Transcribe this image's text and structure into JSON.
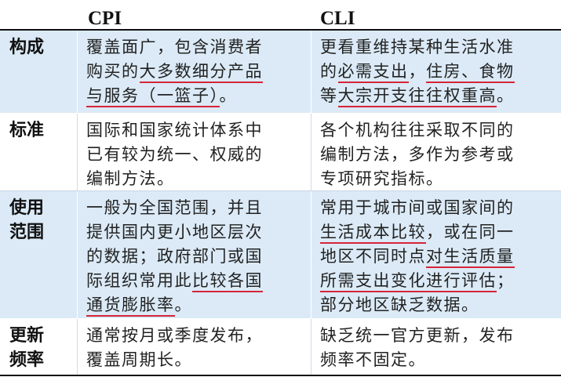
{
  "header": {
    "col1": "CPI",
    "col2": "CLI"
  },
  "rows": [
    {
      "label": [
        "构成"
      ],
      "cpi": [
        [
          {
            "t": "覆盖面广，包含消费者"
          }
        ],
        [
          {
            "t": "购买的"
          },
          {
            "t": "大多数细分产品",
            "u": true
          }
        ],
        [
          {
            "t": "与服务（一篮子）",
            "u": true
          },
          {
            "t": "。"
          }
        ]
      ],
      "cli": [
        [
          {
            "t": "更看重维持某种生活水准"
          }
        ],
        [
          {
            "t": "的"
          },
          {
            "t": "必需支出",
            "u": true
          },
          {
            "t": "，"
          },
          {
            "t": "住房、食物",
            "u": true
          }
        ],
        [
          {
            "t": "等"
          },
          {
            "t": "大宗开支往往权重高",
            "u": true
          },
          {
            "t": "。"
          }
        ]
      ]
    },
    {
      "label": [
        "标准"
      ],
      "cpi": [
        [
          {
            "t": "国际和国家统计体系中"
          }
        ],
        [
          {
            "t": "已有较为统一、权威的"
          }
        ],
        [
          {
            "t": "编制方法。"
          }
        ]
      ],
      "cli": [
        [
          {
            "t": "各个机构往往采取不同的"
          }
        ],
        [
          {
            "t": "编制方法，多作为参考或"
          }
        ],
        [
          {
            "t": "专项研究指标。"
          }
        ]
      ]
    },
    {
      "label": [
        "使用",
        "范围"
      ],
      "cpi": [
        [
          {
            "t": "一般为全国范围，并且"
          }
        ],
        [
          {
            "t": "提供国内更小地区层次"
          }
        ],
        [
          {
            "t": "的数据；政府部门或国"
          }
        ],
        [
          {
            "t": "际组织常用此"
          },
          {
            "t": "比较各国",
            "u": true
          }
        ],
        [
          {
            "t": "通货膨胀率",
            "u": true
          },
          {
            "t": "。"
          }
        ]
      ],
      "cli": [
        [
          {
            "t": "常用于城市间或国家间的"
          }
        ],
        [
          {
            "t": "生活成本比较",
            "u": true
          },
          {
            "t": "，或在同一"
          }
        ],
        [
          {
            "t": "地区不同时点"
          },
          {
            "t": "对生活质量",
            "u": true
          }
        ],
        [
          {
            "t": "所需支出变化进行评估",
            "u": true
          },
          {
            "t": "；"
          }
        ],
        [
          {
            "t": "部分地区缺乏数据。"
          }
        ]
      ]
    },
    {
      "label": [
        "更新",
        "频率"
      ],
      "cpi": [
        [
          {
            "t": "通常按月或季度发布，"
          }
        ],
        [
          {
            "t": "覆盖周期长。"
          }
        ]
      ],
      "cli": [
        [
          {
            "t": "缺乏统一官方更新，发布"
          }
        ],
        [
          {
            "t": "频率不固定。"
          }
        ]
      ]
    }
  ],
  "colors": {
    "shade": "#dbeaf6",
    "underline": "#d6243a"
  }
}
